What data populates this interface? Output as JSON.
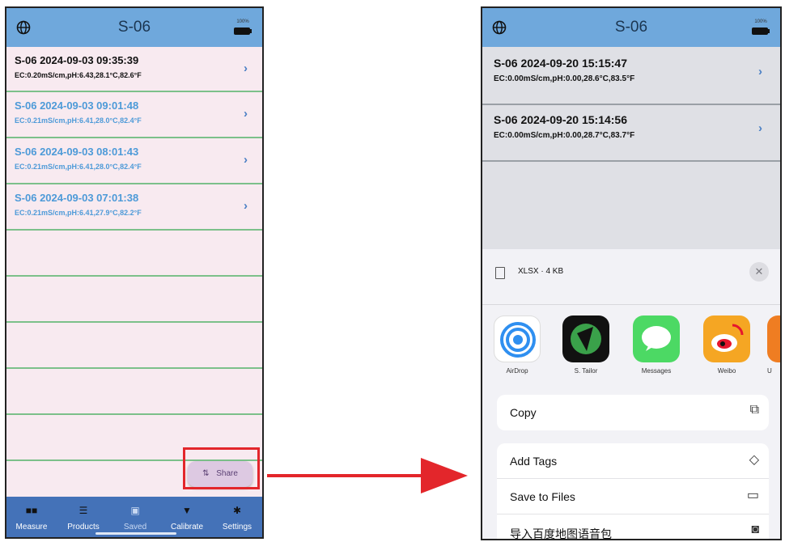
{
  "left": {
    "title": "S-06",
    "battery_pct": "100%",
    "records": [
      {
        "l1": "S-06  2024-09-03 09:35:39",
        "l2": "EC:0.20mS/cm,pH:6.43,28.1°C,82.6°F"
      },
      {
        "l1": "S-06  2024-09-03 09:01:48",
        "l2": "EC:0.21mS/cm,pH:6.41,28.0°C,82.4°F"
      },
      {
        "l1": "S-06  2024-09-03 08:01:43",
        "l2": "EC:0.21mS/cm,pH:6.41,28.0°C,82.4°F"
      },
      {
        "l1": "S-06  2024-09-03 07:01:38",
        "l2": "EC:0.21mS/cm,pH:6.41,27.9°C,82.2°F"
      }
    ],
    "chevron": "›",
    "share_label": "Share",
    "tabs": [
      {
        "label": "Measure",
        "icon": "grid-icon"
      },
      {
        "label": "Products",
        "icon": "list-icon"
      },
      {
        "label": "Saved",
        "icon": "save-icon"
      },
      {
        "label": "Calibrate",
        "icon": "calibrate-icon"
      },
      {
        "label": "Settings",
        "icon": "gear-icon"
      }
    ]
  },
  "right": {
    "title": "S-06",
    "battery_pct": "100%",
    "records": [
      {
        "l1": "S-06  2024-09-20 15:15:47",
        "l2": "EC:0.00mS/cm,pH:0.00,28.6°C,83.5°F"
      },
      {
        "l1": "S-06  2024-09-20 15:14:56",
        "l2": "EC:0.00mS/cm,pH:0.00,28.7°C,83.7°F"
      }
    ],
    "chevron": "›",
    "file_info": "XLSX · 4 KB",
    "close_label": "✕",
    "apps": [
      {
        "name": "AirDrop"
      },
      {
        "name": "S. Tailor"
      },
      {
        "name": "Messages"
      },
      {
        "name": "Weibo"
      },
      {
        "name": "U"
      }
    ],
    "actions": [
      {
        "label": "Copy",
        "icon": "copy-icon"
      },
      {
        "label": "Add Tags",
        "icon": "tag-icon"
      },
      {
        "label": "Save to Files",
        "icon": "folder-icon"
      },
      {
        "label": "导入百度地图语音包",
        "icon": "baidu-map-icon"
      }
    ]
  },
  "colors": {
    "header": "#6fa8dc",
    "tabbar": "#4472b8",
    "row_bg": "#f8eaf0",
    "row_divider": "#7cc08a",
    "muted_text": "#4d9ad8",
    "highlight": "#e3262b"
  }
}
